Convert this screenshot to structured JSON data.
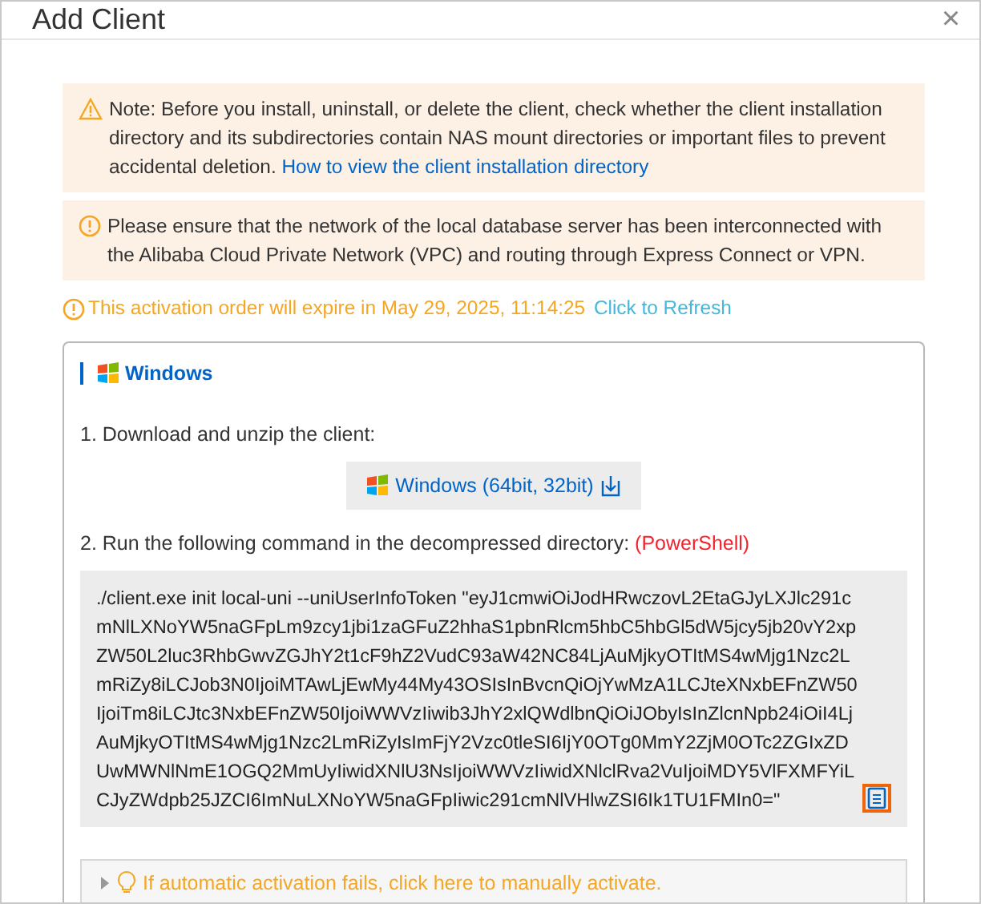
{
  "dialog": {
    "title": "Add Client",
    "close": "×"
  },
  "alerts": [
    {
      "kind": "warning",
      "text": "Note: Before you install, uninstall, or delete the client, check whether the client installation directory and its subdirectories contain NAS mount directories or important files to prevent accidental deletion.",
      "link": "How to view the client installation directory"
    },
    {
      "kind": "info",
      "text": "Please ensure that the network of the local database server has been interconnected with the Alibaba Cloud Private Network (VPC) and routing through Express Connect or VPN."
    }
  ],
  "expiry": {
    "text": "This activation order will expire in May 29, 2025, 11:14:25",
    "link": "Click to Refresh"
  },
  "panel": {
    "title": "Windows",
    "step_1": "1. Download and unzip the client:",
    "download_button": "Windows (64bit, 32bit)",
    "step_2": "2. Run the following command in the decompressed directory:",
    "step_2_shell": "(PowerShell)",
    "command": "./client.exe init local-uni --uniUserInfoToken \"eyJ1cmwiOiJodHRwczovL2EtaGJyLXJlc291cmNlLXNoYW5naGFpLm9zcy1jbi1zaGFuZ2hhaS1pbnRlcm5hbC5hbGl5dW5jcy5jb20vY2xpZW50L2luc3RhbGwvZGJhY2t1cF9hZ2VudC93aW42NC84LjAuMjkyOTItMS4wMjg1Nzc2LmRiZy8iLCJob3N0IjoiMTAwLjEwMy44My43OSIsInBvcnQiOjYwMzA1LCJteXNxbEFnZW50IjoiTm8iLCJtc3NxbEFnZW50IjoiWWVzIiwib3JhY2xlQWdlbnQiOiJObyIsInZlcnNpb24iOiI4LjAuMjkyOTItMS4wMjg1Nzc2LmRiZyIsImFjY2Vzc0tleSI6IjY0OTg0MmY2ZjM0OTc2ZGIxZDUwMWNlNmE1OGQ2MmUyIiwidXNlU3NsIjoiWWVzIiwidXNlclRva2VuIjoiMDY5VlFXMFYiLCJyZWdpb25JZCI6ImNuLXNoYW5naGFpIiwic291cmNlVHlwZSI6Ik1TU1FMIn0=\"",
    "manual": {
      "text": "If automatic activation fails, click here to manually activate.",
      "expanded": false
    }
  }
}
